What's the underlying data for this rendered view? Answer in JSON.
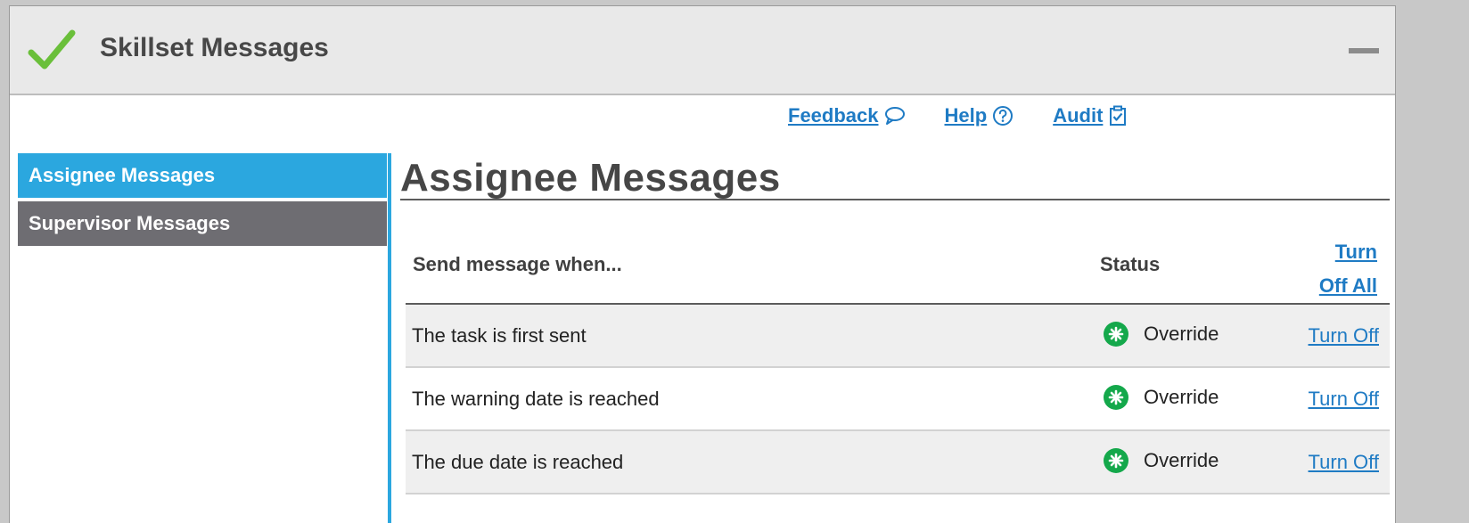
{
  "window": {
    "title": "Skillset Messages",
    "icons": {
      "title": "checkmark-icon",
      "minimize": "minimize-icon"
    }
  },
  "toplinks": {
    "feedback": {
      "label": "Feedback",
      "icon": "speech-bubble-icon"
    },
    "help": {
      "label": "Help",
      "icon": "question-circle-icon"
    },
    "audit": {
      "label": "Audit",
      "icon": "clipboard-check-icon"
    }
  },
  "sidebar": {
    "items": [
      {
        "label": "Assignee Messages",
        "active": true
      },
      {
        "label": "Supervisor Messages",
        "active": false
      }
    ]
  },
  "main": {
    "title": "Assignee Messages",
    "table": {
      "headers": {
        "send": "Send message when...",
        "status": "Status",
        "turn_off_all_line1": "Turn",
        "turn_off_all_line2": "Off All"
      },
      "rows": [
        {
          "description": "The task is first sent",
          "status": "Override",
          "action": "Turn Off"
        },
        {
          "description": "The warning date is reached",
          "status": "Override",
          "action": "Turn Off"
        },
        {
          "description": "The due date is reached",
          "status": "Override",
          "action": "Turn Off"
        }
      ]
    }
  },
  "colors": {
    "accent": "#2ba7df",
    "inactive_tab": "#6e6d72",
    "link": "#1f7bc4",
    "status_green": "#14a84b",
    "check_green": "#6abf3a"
  }
}
